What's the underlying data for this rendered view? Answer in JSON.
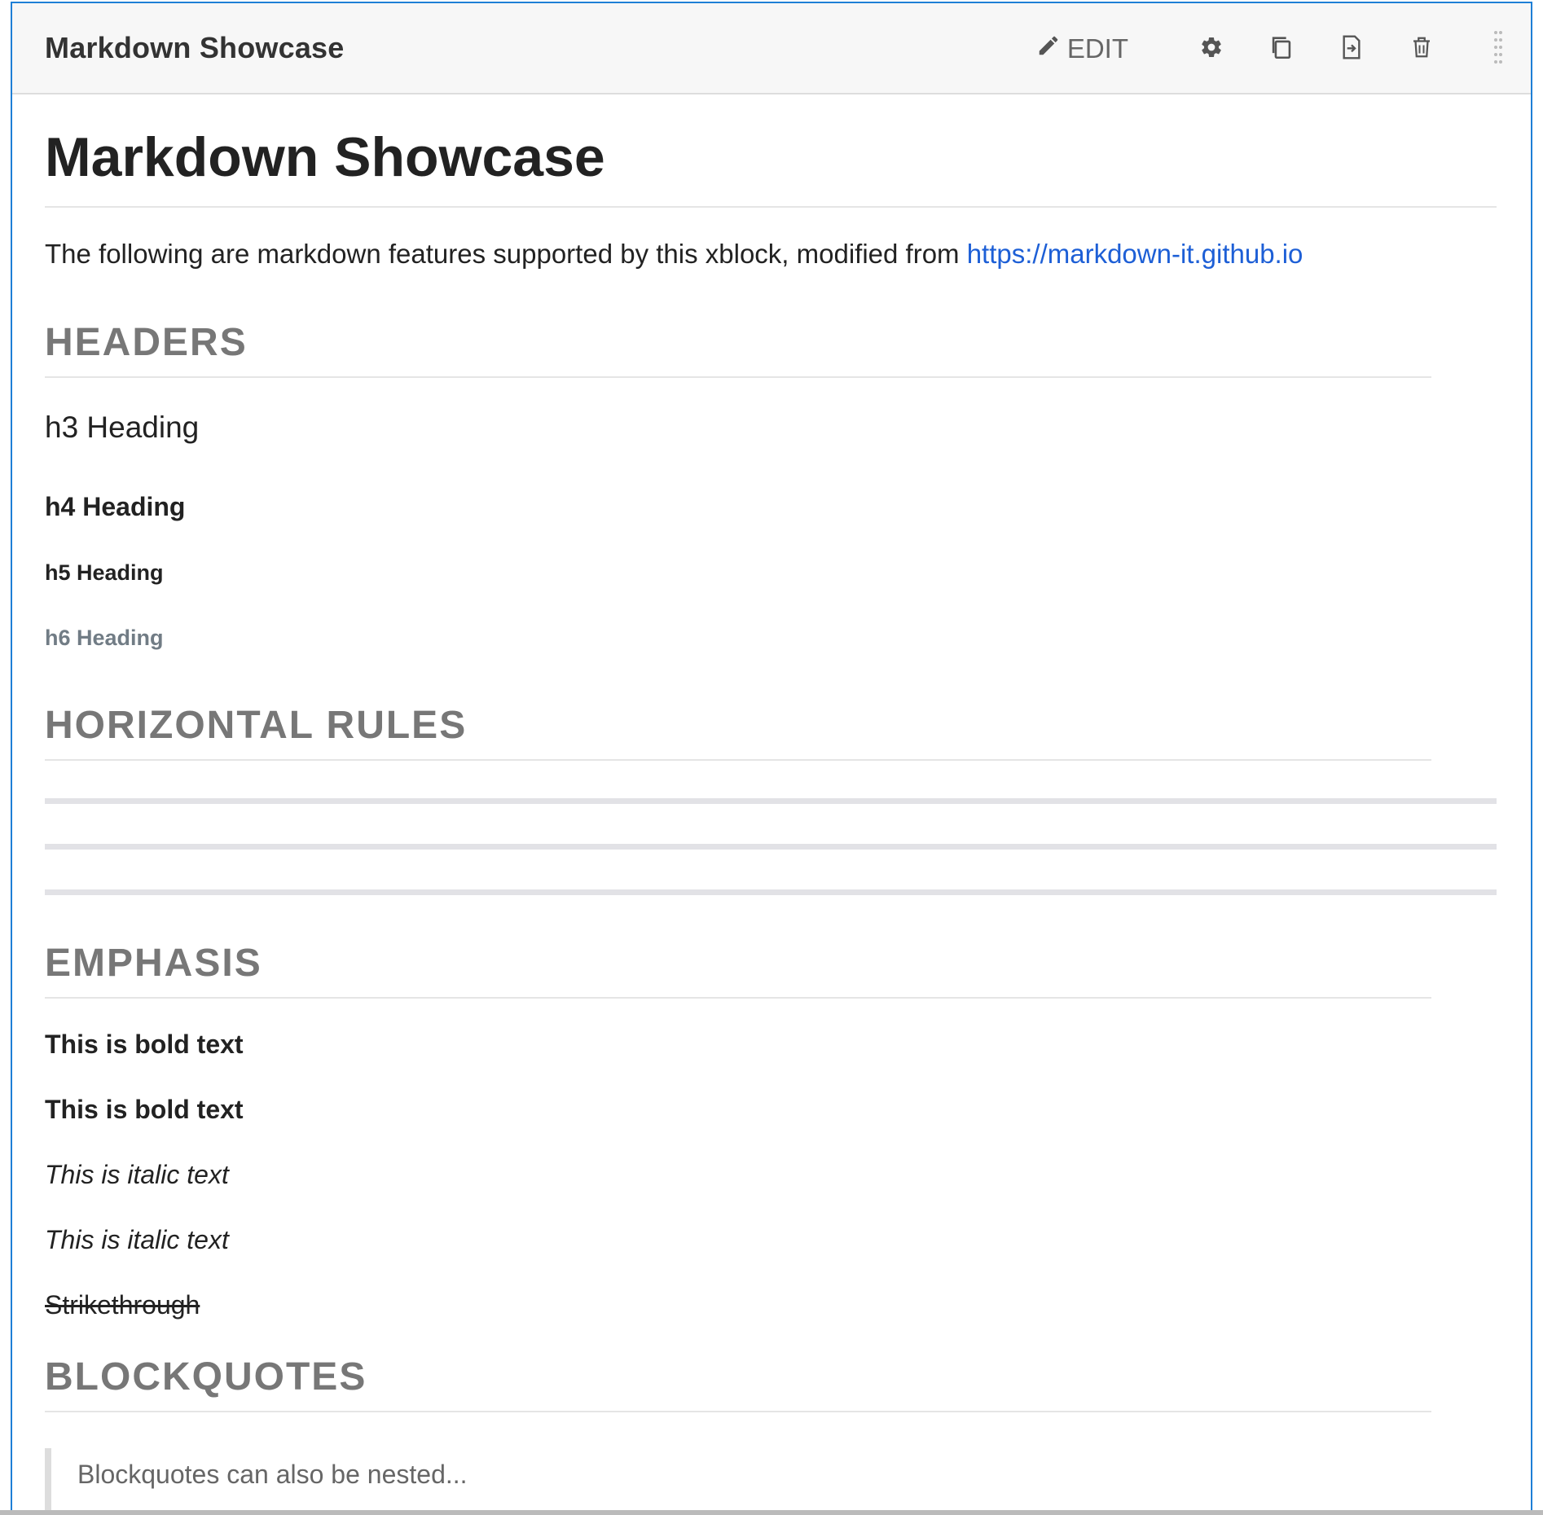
{
  "header": {
    "title": "Markdown Showcase",
    "edit_label": "EDIT",
    "icons": [
      "pencil-icon",
      "gear-icon",
      "duplicate-icon",
      "move-icon",
      "trash-icon",
      "drag-handle-icon"
    ]
  },
  "page": {
    "h1": "Markdown Showcase",
    "intro_text": "The following are markdown features supported by this xblock, modified from ",
    "intro_link": "https://markdown-it.github.io"
  },
  "sections": {
    "headers": {
      "title": "HEADERS",
      "h3": "h3 Heading",
      "h4": "h4 Heading",
      "h5": "h5 Heading",
      "h6": "h6 Heading"
    },
    "horizontal_rules": {
      "title": "HORIZONTAL RULES"
    },
    "emphasis": {
      "title": "EMPHASIS",
      "bold_1": "This is bold text",
      "bold_2": "This is bold text",
      "italic_1": "This is italic text",
      "italic_2": "This is italic text",
      "strike": "Strikethrough"
    },
    "blockquotes": {
      "title": "BLOCKQUOTES",
      "quote": "Blockquotes can also be nested..."
    }
  },
  "colors": {
    "accent_border": "#1e7fd6",
    "link": "#1d5fd6",
    "section_heading": "#777777",
    "muted_heading": "#717c85"
  }
}
